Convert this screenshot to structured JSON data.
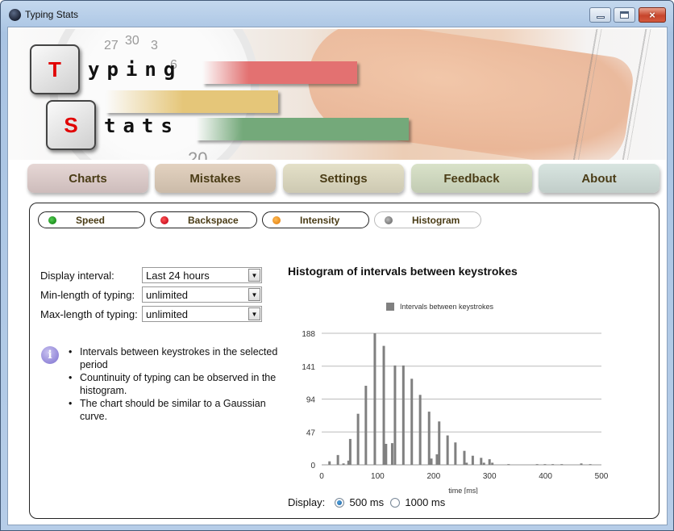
{
  "window": {
    "title": "Typing Stats",
    "controls": {
      "minimize": "minimize",
      "maximize": "maximize",
      "close": "×"
    }
  },
  "banner": {
    "key1": "T",
    "word1": "yping",
    "key2": "S",
    "word2": "tats",
    "dial_numbers": [
      "27",
      "30",
      "3",
      "6",
      "20"
    ]
  },
  "nav": {
    "items": [
      {
        "label": "Charts"
      },
      {
        "label": "Mistakes"
      },
      {
        "label": "Settings"
      },
      {
        "label": "Feedback"
      },
      {
        "label": "About"
      }
    ]
  },
  "subtabs": [
    {
      "label": "Speed",
      "color": "#1a8f1a"
    },
    {
      "label": "Backspace",
      "color": "#cc1122"
    },
    {
      "label": "Intensity",
      "color": "#e88a1a"
    },
    {
      "label": "Histogram",
      "color": "#888888"
    }
  ],
  "form": {
    "display_interval": {
      "label": "Display interval:",
      "value": "Last 24 hours"
    },
    "min_length": {
      "label": "Min-length of typing:",
      "value": "unlimited"
    },
    "max_length": {
      "label": "Max-length of typing:",
      "value": "unlimited"
    }
  },
  "info": {
    "icon": "i",
    "bullets": [
      "Intervals between keystrokes in the selected period",
      "Countinuity of typing can be observed in the histogram.",
      "The chart should be similar to a Gaussian curve."
    ]
  },
  "display": {
    "label": "Display:",
    "options": [
      {
        "label": "500 ms",
        "checked": true
      },
      {
        "label": "1000 ms",
        "checked": false
      }
    ]
  },
  "chart_data": {
    "type": "bar",
    "title": "Histogram of intervals between keystrokes",
    "legend": [
      "Intervals between keystrokes"
    ],
    "legend_position": "top-center",
    "xlabel": "time [ms]",
    "ylabel": "",
    "xlim": [
      0,
      500
    ],
    "ylim": [
      0,
      188
    ],
    "xticks": [
      0,
      100,
      200,
      300,
      400,
      500
    ],
    "yticks": [
      0,
      47,
      94,
      141,
      188
    ],
    "grid": true,
    "series": [
      {
        "name": "Intervals between keystrokes",
        "color": "#808080",
        "x": [
          14,
          29,
          39,
          48,
          51,
          65,
          79,
          95,
          111,
          115,
          126,
          131,
          146,
          161,
          176,
          192,
          196,
          206,
          210,
          225,
          239,
          255,
          259,
          270,
          285,
          290,
          300,
          305,
          334,
          385,
          399,
          413,
          429,
          464,
          480
        ],
        "values": [
          5,
          14,
          2,
          6,
          37,
          73,
          113,
          188,
          170,
          30,
          31,
          142,
          142,
          123,
          100,
          76,
          9,
          15,
          62,
          42,
          32,
          20,
          3,
          13,
          10,
          3,
          8,
          3,
          1,
          1,
          1,
          1,
          1,
          2,
          1
        ]
      }
    ]
  }
}
